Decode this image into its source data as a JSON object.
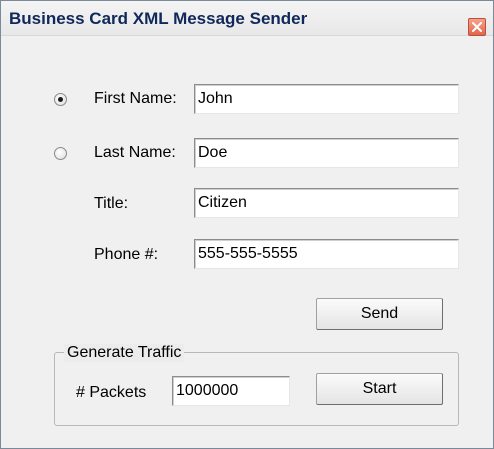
{
  "window": {
    "title": "Business Card XML Message Sender",
    "close_icon": "close-icon"
  },
  "form": {
    "first_name_label": "First Name:",
    "first_name_value": "John",
    "first_name_selected": true,
    "last_name_label": "Last Name:",
    "last_name_value": "Doe",
    "last_name_selected": false,
    "title_label": "Title:",
    "title_value": "Citizen",
    "phone_label": "Phone #:",
    "phone_value": "555-555-5555",
    "send_label": "Send"
  },
  "traffic": {
    "group_label": "Generate Traffic",
    "packets_label": "# Packets",
    "packets_value": "1000000",
    "start_label": "Start"
  },
  "colors": {
    "title_text": "#10285a",
    "close_button": "#e2644c",
    "client_bg": "#ececec"
  }
}
